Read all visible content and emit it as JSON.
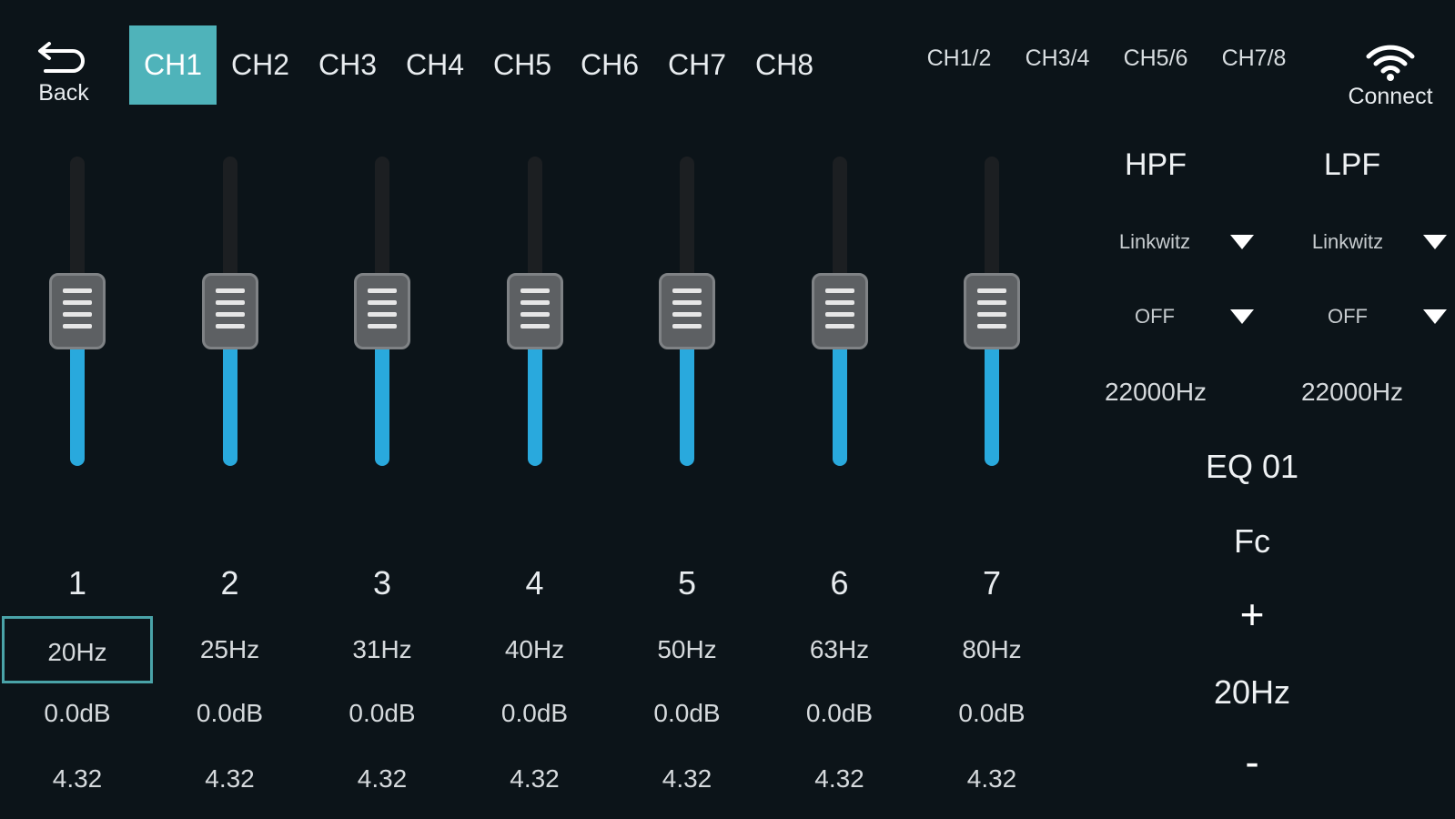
{
  "header": {
    "back_label": "Back",
    "connect_label": "Connect",
    "channels": [
      "CH1",
      "CH2",
      "CH3",
      "CH4",
      "CH5",
      "CH6",
      "CH7",
      "CH8"
    ],
    "active_channel": "CH1",
    "links": [
      "CH1/2",
      "CH3/4",
      "CH5/6",
      "CH7/8"
    ]
  },
  "bands": [
    {
      "num": "1",
      "freq": "20Hz",
      "gain": "0.0dB",
      "q": "4.32",
      "level": 0.5,
      "selected": true
    },
    {
      "num": "2",
      "freq": "25Hz",
      "gain": "0.0dB",
      "q": "4.32",
      "level": 0.5,
      "selected": false
    },
    {
      "num": "3",
      "freq": "31Hz",
      "gain": "0.0dB",
      "q": "4.32",
      "level": 0.5,
      "selected": false
    },
    {
      "num": "4",
      "freq": "40Hz",
      "gain": "0.0dB",
      "q": "4.32",
      "level": 0.5,
      "selected": false
    },
    {
      "num": "5",
      "freq": "50Hz",
      "gain": "0.0dB",
      "q": "4.32",
      "level": 0.5,
      "selected": false
    },
    {
      "num": "6",
      "freq": "63Hz",
      "gain": "0.0dB",
      "q": "4.32",
      "level": 0.5,
      "selected": false
    },
    {
      "num": "7",
      "freq": "80Hz",
      "gain": "0.0dB",
      "q": "4.32",
      "level": 0.5,
      "selected": false
    }
  ],
  "hpf": {
    "title": "HPF",
    "type": "Linkwitz",
    "slope": "OFF",
    "freq": "22000Hz"
  },
  "lpf": {
    "title": "LPF",
    "type": "Linkwitz",
    "slope": "OFF",
    "freq": "22000Hz"
  },
  "eq": {
    "preset": "EQ 01",
    "fc_label": "Fc",
    "plus": "+",
    "fc_value": "20Hz",
    "minus": "-"
  },
  "colors": {
    "background": "#0c1419",
    "accent": "#4fb3ba",
    "slider_fill": "#29a9dd"
  }
}
